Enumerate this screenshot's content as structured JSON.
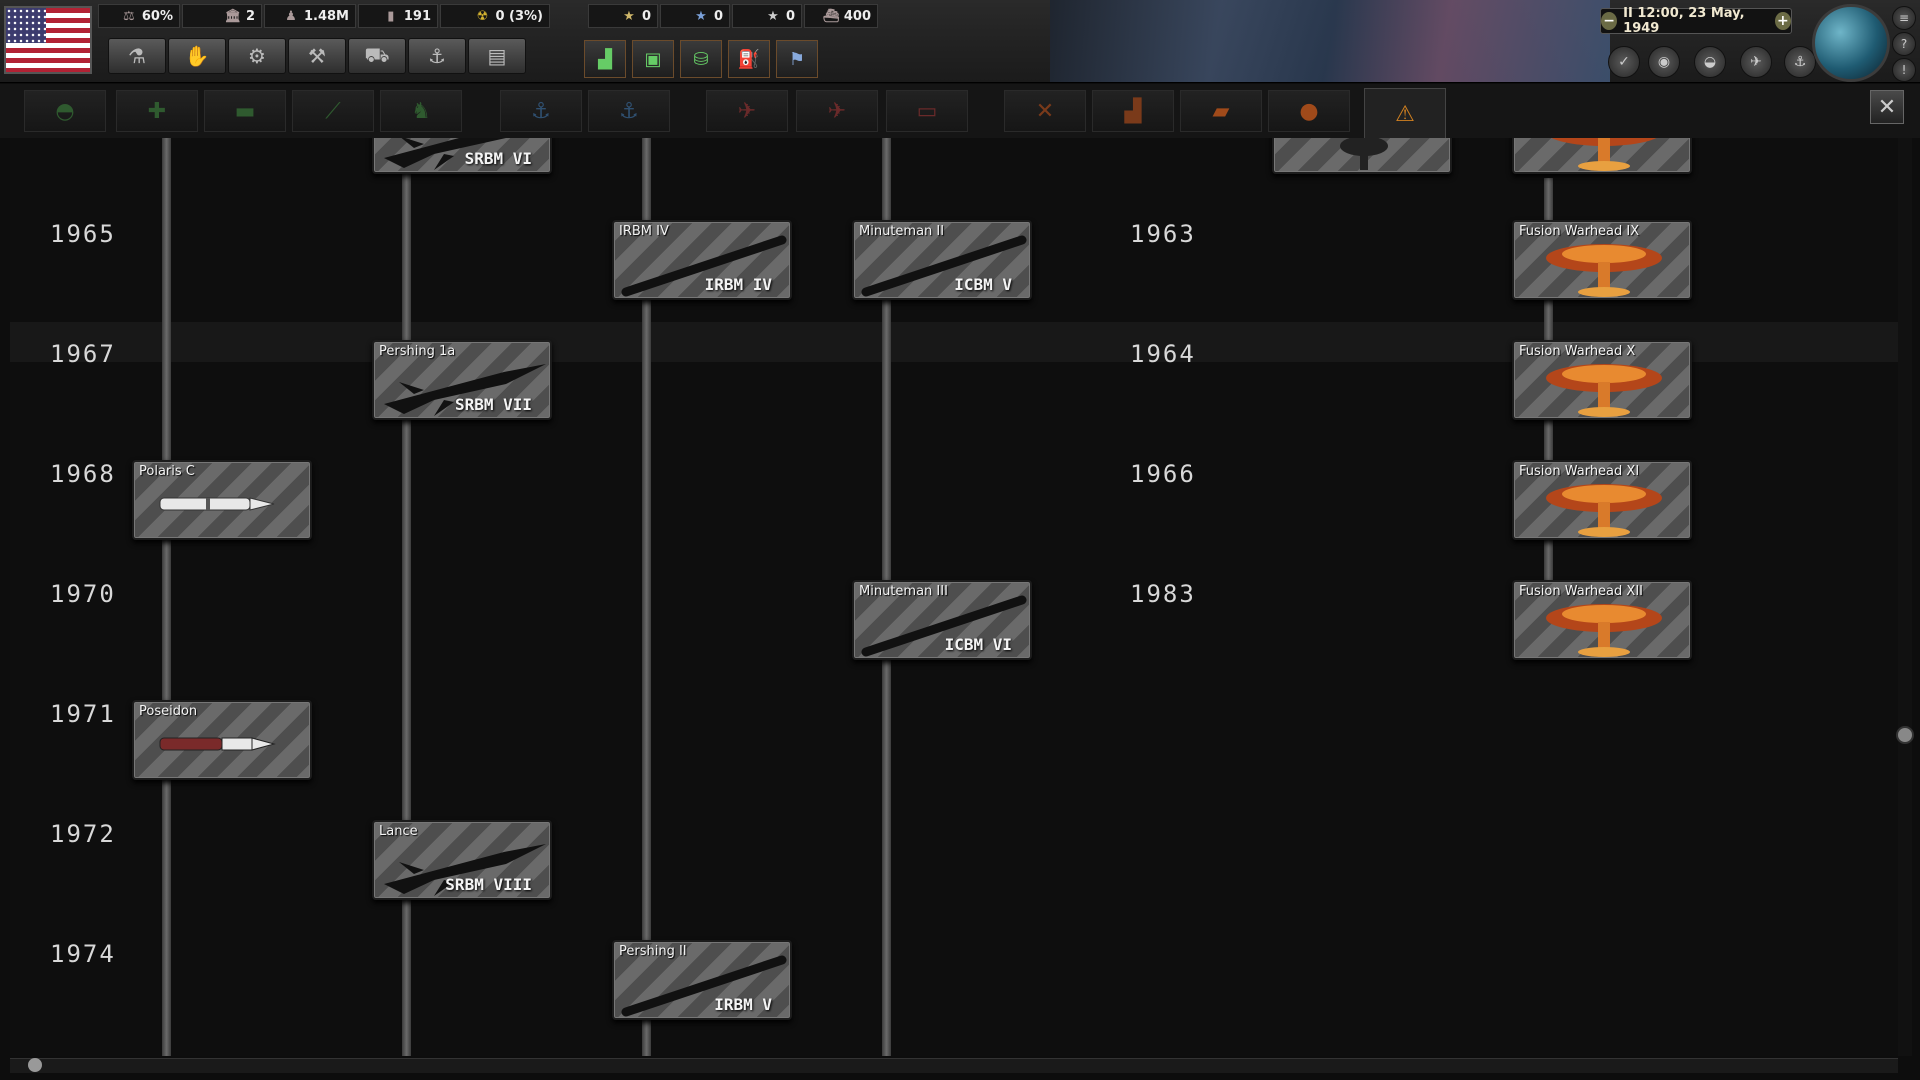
{
  "topbar": {
    "resources": [
      {
        "icon": "stability-icon",
        "value": "60%"
      },
      {
        "icon": "political-power-icon",
        "value": "2"
      },
      {
        "icon": "manpower-icon",
        "value": "1.48M"
      },
      {
        "icon": "factory-icon",
        "value": "191"
      },
      {
        "icon": "nuke-icon",
        "value": "0 (3%)"
      }
    ],
    "stars": [
      {
        "icon": "star-icon",
        "value": "0"
      },
      {
        "icon": "star-icon",
        "value": "0"
      },
      {
        "icon": "star-icon",
        "value": "0"
      },
      {
        "icon": "ship-icon",
        "value": "400"
      }
    ],
    "date": "II 12:00, 23 May, 1949",
    "tools": [
      "research-icon",
      "diplomacy-icon",
      "trade-icon",
      "production-icon",
      "army-icon",
      "navy-icon",
      "logistics-icon"
    ],
    "alerts": [
      "industry-alert-icon",
      "research-alert-icon",
      "production-alert-icon",
      "fuel-alert-icon",
      "ideas-alert-icon"
    ]
  },
  "tabs": [
    "infantry-icon",
    "support-icon",
    "armor-icon",
    "artillery-icon",
    "land-doctrine-icon",
    "naval-icon",
    "naval-doctrine-icon",
    "air-icon",
    "air-doctrine-icon",
    "helicopter-icon",
    "engineering-icon",
    "industry-icon",
    "electronics-icon",
    "nuclear-icon",
    "missile-tree-icon"
  ],
  "tree": {
    "years_left": [
      {
        "label": "1965"
      },
      {
        "label": "1967"
      },
      {
        "label": "1968"
      },
      {
        "label": "1970"
      },
      {
        "label": "1971"
      },
      {
        "label": "1972"
      },
      {
        "label": "1974"
      }
    ],
    "years_right": [
      {
        "label": "1963"
      },
      {
        "label": "1964"
      },
      {
        "label": "1966"
      },
      {
        "label": "1983"
      }
    ],
    "cards": [
      {
        "name": "",
        "cls": "SRBM VI",
        "kind": "srbm"
      },
      {
        "name": "",
        "cls": "",
        "kind": "nuke-small"
      },
      {
        "name": "",
        "cls": "",
        "kind": "fusion"
      },
      {
        "name": "IRBM IV",
        "cls": "IRBM IV",
        "kind": "irbm"
      },
      {
        "name": "Minuteman II",
        "cls": "ICBM V",
        "kind": "icbm"
      },
      {
        "name": "Fusion Warhead IX",
        "cls": "",
        "kind": "fusion"
      },
      {
        "name": "Pershing 1a",
        "cls": "SRBM VII",
        "kind": "srbm"
      },
      {
        "name": "Fusion Warhead X",
        "cls": "",
        "kind": "fusion"
      },
      {
        "name": "Polaris C",
        "cls": "",
        "kind": "slbm-white"
      },
      {
        "name": "Fusion Warhead XI",
        "cls": "",
        "kind": "fusion"
      },
      {
        "name": "Minuteman III",
        "cls": "ICBM VI",
        "kind": "icbm"
      },
      {
        "name": "Fusion Warhead XII",
        "cls": "",
        "kind": "fusion"
      },
      {
        "name": "Poseidon",
        "cls": "",
        "kind": "slbm-red"
      },
      {
        "name": "Lance",
        "cls": "SRBM VIII",
        "kind": "srbm"
      },
      {
        "name": "Pershing II",
        "cls": "IRBM V",
        "kind": "irbm"
      }
    ]
  }
}
